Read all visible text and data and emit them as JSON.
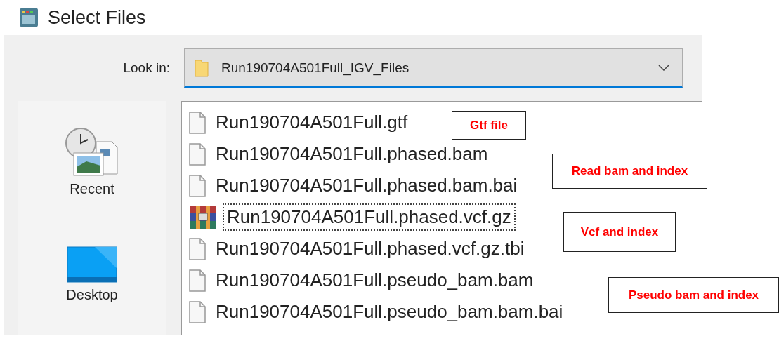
{
  "window": {
    "title": "Select Files"
  },
  "look_in": {
    "label": "Look in:",
    "value": "Run190704A501Full_IGV_Files"
  },
  "sidebar": {
    "items": [
      {
        "label": "Recent",
        "kind": "recent"
      },
      {
        "label": "Desktop",
        "kind": "desktop"
      }
    ]
  },
  "files": [
    {
      "name": "Run190704A501Full.gtf",
      "kind": "document",
      "focused": false
    },
    {
      "name": "Run190704A501Full.phased.bam",
      "kind": "document",
      "focused": false
    },
    {
      "name": "Run190704A501Full.phased.bam.bai",
      "kind": "document",
      "focused": false
    },
    {
      "name": "Run190704A501Full.phased.vcf.gz",
      "kind": "archive",
      "focused": true
    },
    {
      "name": "Run190704A501Full.phased.vcf.gz.tbi",
      "kind": "document",
      "focused": false
    },
    {
      "name": "Run190704A501Full.pseudo_bam.bam",
      "kind": "document",
      "focused": false
    },
    {
      "name": "Run190704A501Full.pseudo_bam.bam.bai",
      "kind": "document",
      "focused": false
    }
  ],
  "annotations": [
    "Gtf file",
    "Read bam and index",
    "Vcf and index",
    "Pseudo bam and index"
  ]
}
